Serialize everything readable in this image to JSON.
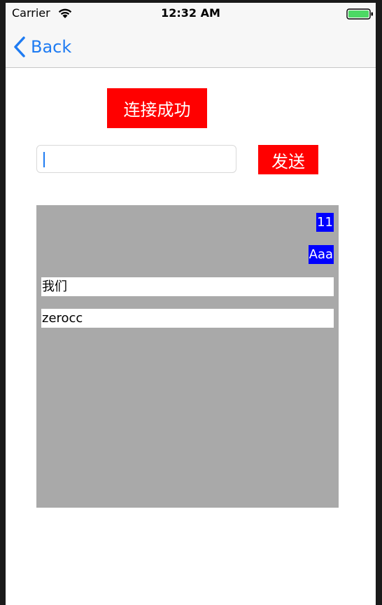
{
  "status_bar": {
    "carrier": "Carrier",
    "time": "12:32 AM",
    "battery_color": "#4cd964"
  },
  "nav": {
    "back_label": "Back",
    "accent_color": "#1e7bf2"
  },
  "connection": {
    "status_label": "连接成功",
    "color": "#ff0000"
  },
  "composer": {
    "input_value": "",
    "send_label": "发送"
  },
  "messages": [
    {
      "text": "11",
      "side": "right"
    },
    {
      "text": "Aaa",
      "side": "right"
    },
    {
      "text": "我们",
      "side": "left"
    },
    {
      "text": "zerocc",
      "side": "left"
    }
  ],
  "colors": {
    "panel": "#a9a9a9",
    "sent_bubble": "#0000ff",
    "received_bubble": "#ffffff"
  }
}
